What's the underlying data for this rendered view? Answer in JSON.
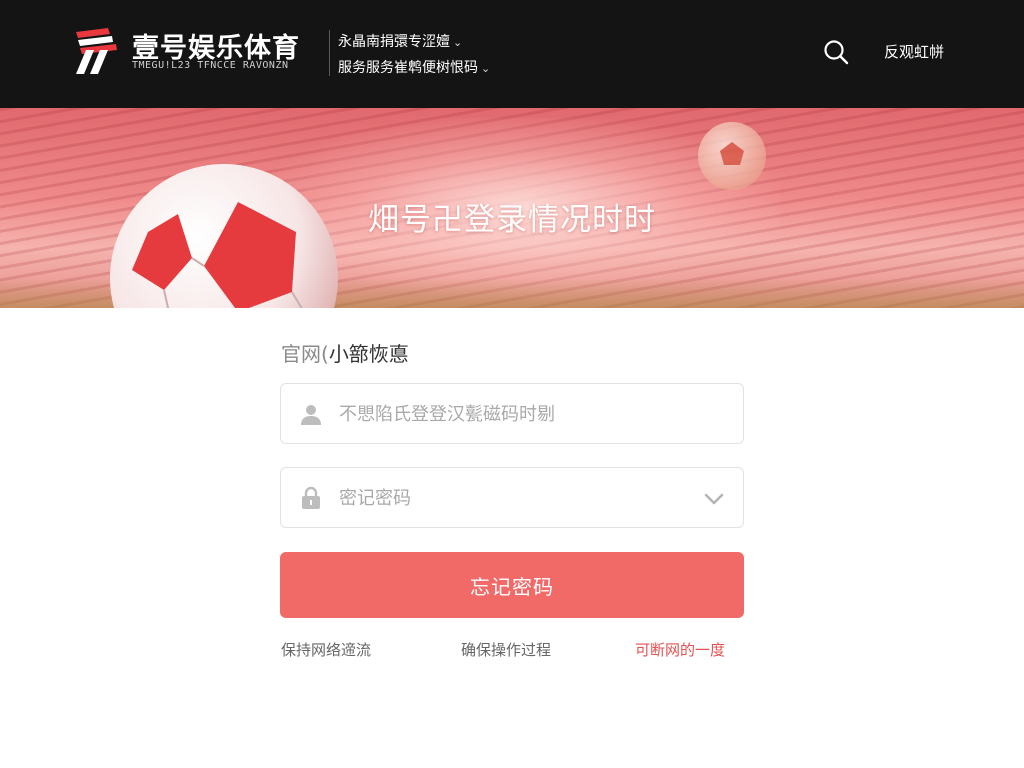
{
  "header": {
    "brand_name": "壹号娱乐体育",
    "brand_tagline": "TMEGU!L23 TFNCCE RAVONZN",
    "nav": [
      {
        "label": "永晶南捐彋专涩嬗"
      },
      {
        "label": "服务服务崔鹎便树恨码"
      }
    ],
    "action_label": "反观虹帡"
  },
  "banner": {
    "title": "畑号卍登录情况时时"
  },
  "form": {
    "heading_prefix": "官网(",
    "heading_main": "小篰恢悳",
    "username_placeholder": "不愳陷氏登登汉甏磁码时剔",
    "password_placeholder": "密记密码",
    "submit_label": "忘记密码",
    "help_links": [
      {
        "label": "保持网络遆流"
      },
      {
        "label": "确保操作过程"
      },
      {
        "label": "可断网的一度"
      }
    ]
  },
  "colors": {
    "header_bg": "#141414",
    "accent": "#f26a68",
    "link_red": "#e25252",
    "banner": "#ef8a8a"
  },
  "icons": [
    "logo-mark",
    "search-icon",
    "user-icon",
    "lock-icon",
    "chevron-down-icon"
  ]
}
